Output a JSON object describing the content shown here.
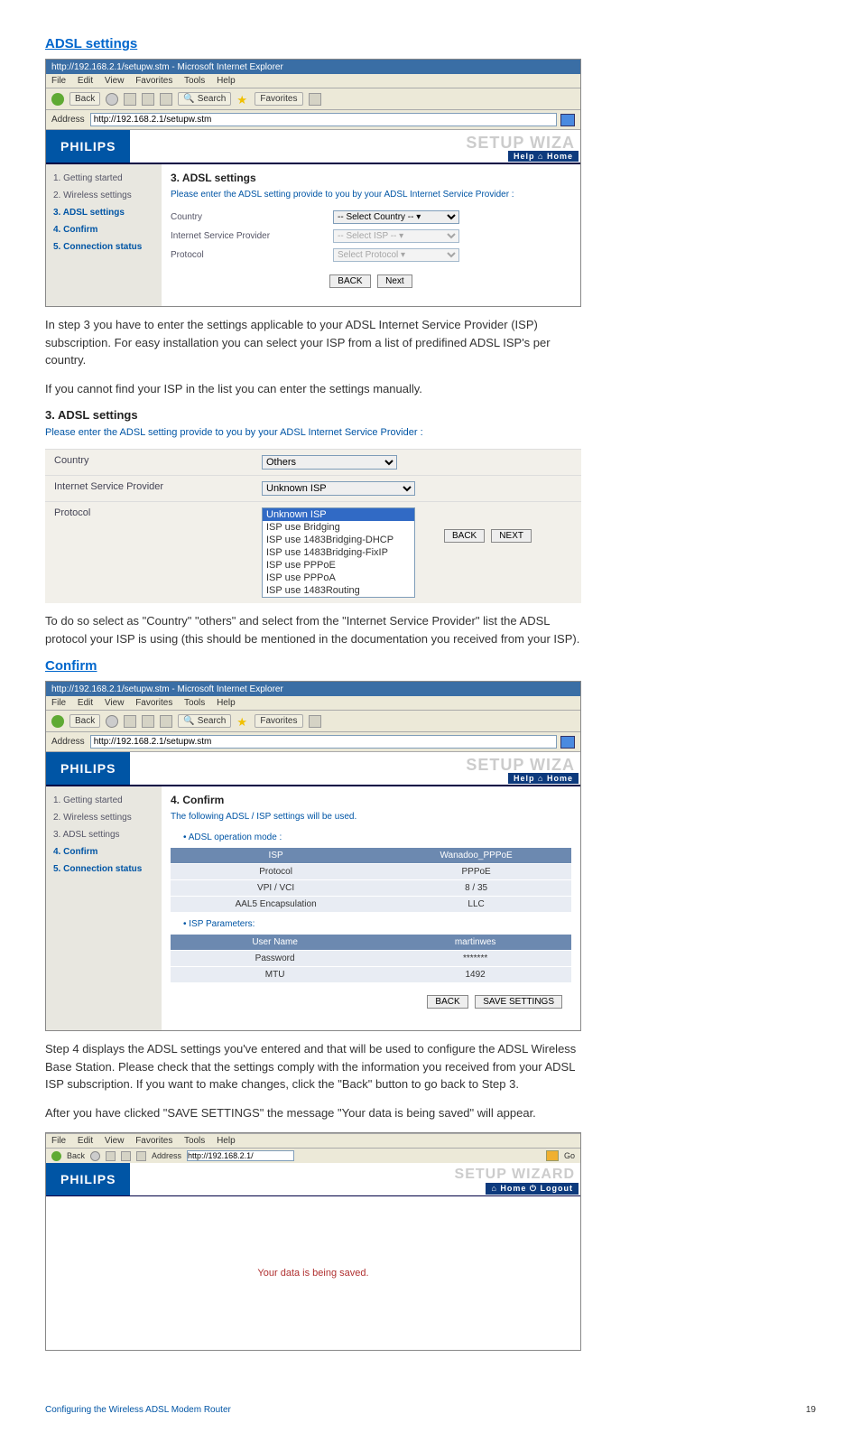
{
  "sections": {
    "adsl_heading": "ADSL settings",
    "confirm_heading": "Confirm"
  },
  "ie_window": {
    "title": "http://192.168.2.1/setupw.stm - Microsoft Internet Explorer",
    "menus": [
      "File",
      "Edit",
      "View",
      "Favorites",
      "Tools",
      "Help"
    ],
    "back": "Back",
    "search": "Search",
    "favorites": "Favorites",
    "address_label": "Address",
    "address_url": "http://192.168.2.1/setupw.stm",
    "go": "Go"
  },
  "philips": {
    "logo": "PHILIPS",
    "setup_wiz": "SETUP WIZA",
    "setup_wizard": "SETUP WIZARD",
    "help_home": "Help ⌂ Home",
    "home_logout": "⌂ Home ⏻ Logout"
  },
  "wizard_sidebar": {
    "s1": "1. Getting started",
    "s2": "2. Wireless settings",
    "s3": "3. ADSL settings",
    "s4": "4. Confirm",
    "s5": "5. Connection status"
  },
  "adsl_screen": {
    "title": "3. ADSL settings",
    "hint": "Please enter the ADSL setting provide to you by your ADSL Internet Service Provider :",
    "country": "Country",
    "isp": "Internet Service Provider",
    "protocol": "Protocol",
    "country_value": "-- Select Country -- ▾",
    "isp_value": "-- Select ISP -- ▾",
    "protocol_value": "Select Protocol ▾",
    "back": "BACK",
    "next": "Next"
  },
  "para1": "In step 3 you have to enter the settings applicable to your ADSL Internet Service Provider (ISP) subscription. For easy installation you can select your ISP from a list of predifined ADSL ISP's per country.",
  "para2": "If you cannot find your ISP in the list you can enter the settings manually.",
  "adsl_inline": {
    "title": "3. ADSL settings",
    "hint": "Please enter the ADSL setting provide to you by your ADSL Internet Service Provider :",
    "country": "Country",
    "isp": "Internet Service Provider",
    "protocol": "Protocol",
    "country_value": "Others",
    "isp_selected": "Unknown ISP",
    "isp_options": [
      "Unknown ISP",
      "ISP use Bridging",
      "ISP use 1483Bridging-DHCP",
      "ISP use 1483Bridging-FixIP",
      "ISP use PPPoE",
      "ISP use PPPoA",
      "ISP use 1483Routing"
    ],
    "back": "BACK",
    "next": "NEXT"
  },
  "para3": "To do so select as \"Country\" \"others\" and select from the \"Internet Service Provider\" list the ADSL protocol your ISP is using (this should be mentioned in the documentation you received from your ISP).",
  "confirm_screen": {
    "title": "4. Confirm",
    "subtitle": "The following ADSL / ISP settings will be used.",
    "bullet1": "ADSL operation mode :",
    "table1": {
      "header": "ISP",
      "header2": "Wanadoo_PPPoE",
      "rows": [
        [
          "Protocol",
          "PPPoE"
        ],
        [
          "VPI / VCI",
          "8 / 35"
        ],
        [
          "AAL5 Encapsulation",
          "LLC"
        ]
      ]
    },
    "bullet2": "ISP Parameters:",
    "table2": {
      "rows": [
        [
          "User Name",
          "martinwes"
        ],
        [
          "Password",
          "*******"
        ],
        [
          "MTU",
          "1492"
        ]
      ]
    },
    "back": "BACK",
    "save": "SAVE SETTINGS"
  },
  "para4": "Step 4 displays the ADSL settings you've entered and that will be used to configure the ADSL Wireless Base Station. Please check that the settings comply with the information you received from your ADSL ISP subscription. If you want to make changes, click the \"Back\" button to go back to Step 3.",
  "para5": "After you have clicked \"SAVE SETTINGS\" the message \"Your data is being saved\" will appear.",
  "saving": {
    "url": "http://192.168.2.1/",
    "msg": "Your data is being saved."
  },
  "footer": {
    "left": "Configuring the Wireless ADSL Modem Router",
    "page": "19"
  }
}
